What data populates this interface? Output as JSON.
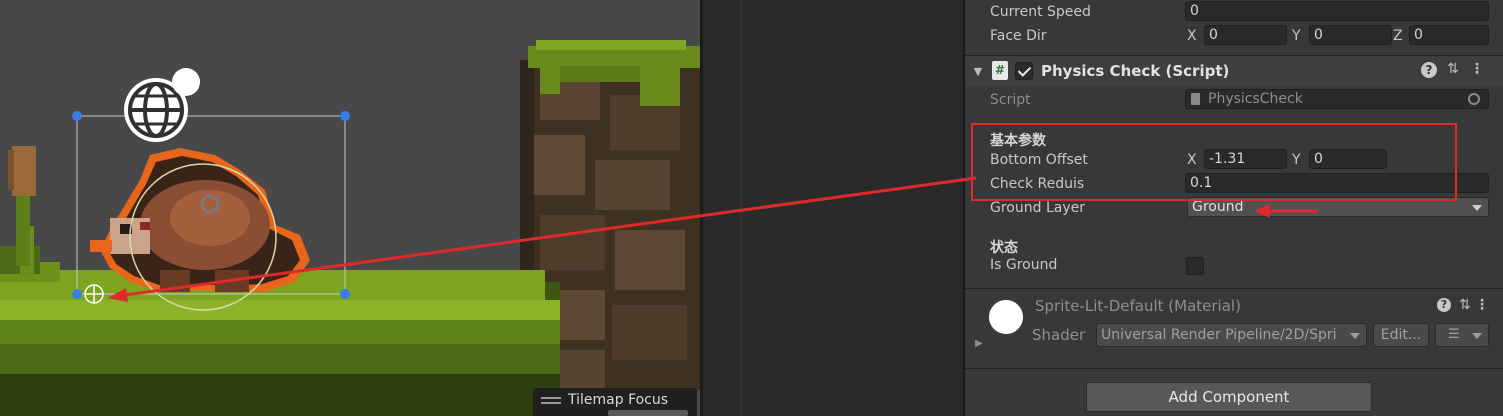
{
  "scene": {
    "hud_label": "Tilemap Focus"
  },
  "inspector": {
    "top_fields": [
      {
        "label": "Current Speed",
        "value": "0"
      }
    ],
    "face_dir": {
      "label": "Face Dir",
      "x_axis": "X",
      "x": "0",
      "y_axis": "Y",
      "y": "0",
      "z_axis": "Z",
      "z": "0"
    },
    "component": {
      "title": "Physics Check (Script)",
      "enabled": true,
      "script_label": "Script",
      "script_value": "PhysicsCheck",
      "section_basic": "基本参数",
      "bottom_offset": {
        "label": "Bottom Offset",
        "x_axis": "X",
        "x": "-1.31",
        "y_axis": "Y",
        "y": "0"
      },
      "check_radius": {
        "label": "Check Reduis",
        "value": "0.1"
      },
      "ground_layer": {
        "label": "Ground Layer",
        "value": "Ground"
      },
      "section_state": "状态",
      "is_ground": {
        "label": "Is Ground",
        "checked": false
      }
    },
    "material": {
      "title": "Sprite-Lit-Default (Material)",
      "shader_label": "Shader",
      "shader_value": "Universal Render Pipeline/2D/Spri",
      "edit_label": "Edit..."
    },
    "add_component_label": "Add Component"
  },
  "colors": {
    "annotation_red": "#e02a2a",
    "field_bg": "#2a2a2a",
    "panel_bg": "#383838",
    "selection_handle": "#3a7de0"
  }
}
